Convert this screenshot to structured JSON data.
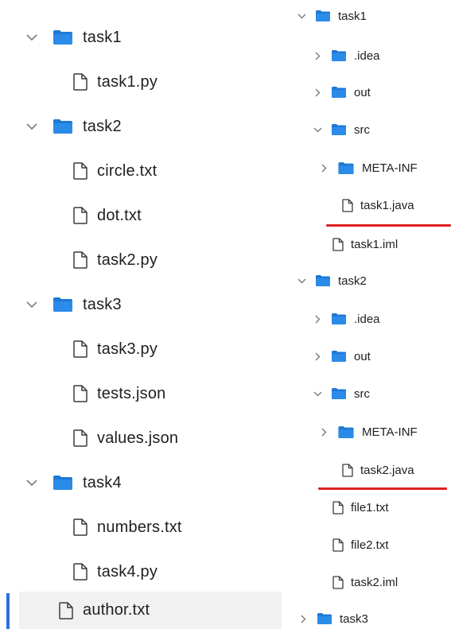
{
  "left_tree": {
    "items": [
      {
        "label": "task1",
        "type": "folder",
        "expanded": true
      },
      {
        "label": "task1.py",
        "type": "file"
      },
      {
        "label": "task2",
        "type": "folder",
        "expanded": true
      },
      {
        "label": "circle.txt",
        "type": "file"
      },
      {
        "label": "dot.txt",
        "type": "file"
      },
      {
        "label": "task2.py",
        "type": "file"
      },
      {
        "label": "task3",
        "type": "folder",
        "expanded": true
      },
      {
        "label": "task3.py",
        "type": "file"
      },
      {
        "label": "tests.json",
        "type": "file"
      },
      {
        "label": "values.json",
        "type": "file"
      },
      {
        "label": "task4",
        "type": "folder",
        "expanded": true
      },
      {
        "label": "numbers.txt",
        "type": "file"
      },
      {
        "label": "task4.py",
        "type": "file"
      },
      {
        "label": "author.txt",
        "type": "file",
        "selected": true
      }
    ]
  },
  "right_tree": {
    "items": [
      {
        "label": "task1",
        "type": "folder",
        "expanded": true
      },
      {
        "label": ".idea",
        "type": "folder",
        "expanded": false
      },
      {
        "label": "out",
        "type": "folder",
        "expanded": false
      },
      {
        "label": "src",
        "type": "folder",
        "expanded": true
      },
      {
        "label": "META-INF",
        "type": "folder",
        "expanded": false
      },
      {
        "label": "task1.java",
        "type": "file",
        "underlined": true
      },
      {
        "label": "task1.iml",
        "type": "file"
      },
      {
        "label": "task2",
        "type": "folder",
        "expanded": true
      },
      {
        "label": ".idea",
        "type": "folder",
        "expanded": false
      },
      {
        "label": "out",
        "type": "folder",
        "expanded": false
      },
      {
        "label": "src",
        "type": "folder",
        "expanded": true
      },
      {
        "label": "META-INF",
        "type": "folder",
        "expanded": false
      },
      {
        "label": "task2.java",
        "type": "file",
        "underlined": true
      },
      {
        "label": "file1.txt",
        "type": "file"
      },
      {
        "label": "file2.txt",
        "type": "file"
      },
      {
        "label": "task2.iml",
        "type": "file"
      },
      {
        "label": "task3",
        "type": "folder",
        "expanded": false
      }
    ]
  },
  "colors": {
    "folder": "#2b8be8",
    "folder_back": "#1f79d6",
    "chevron": "#7a7a7a",
    "file_outline": "#3a3a3a",
    "selected_bg": "#f1f1f1",
    "selection_bar": "#2a6fdb",
    "underline": "#e02020",
    "text": "#1f1f1f"
  }
}
